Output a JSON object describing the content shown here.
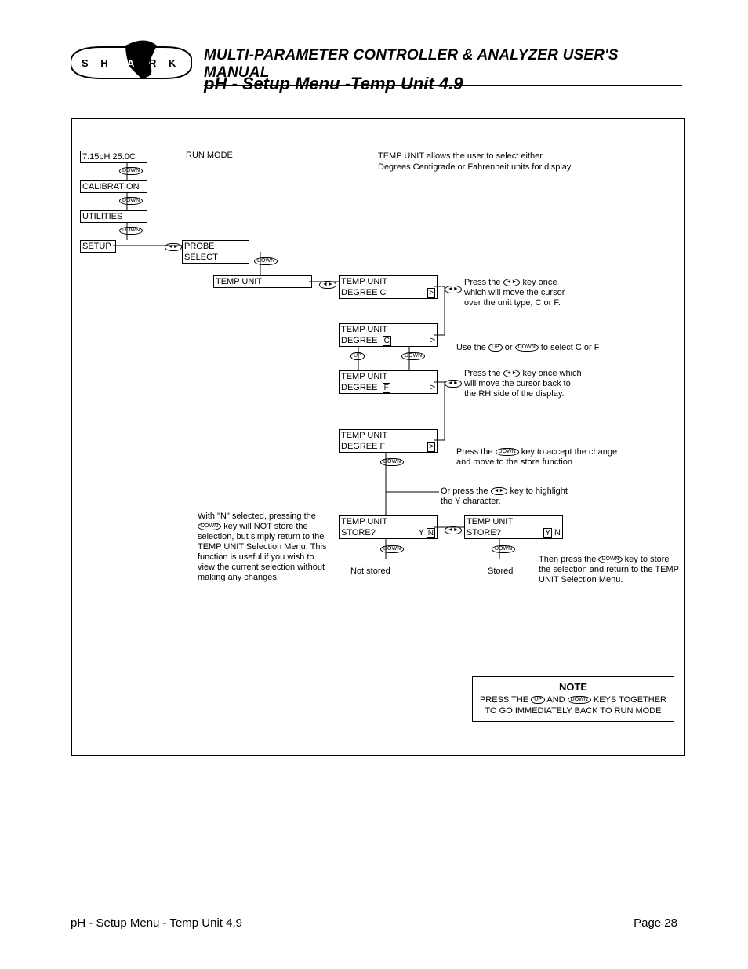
{
  "header": {
    "logo_text": "S H A R K",
    "title": "MULTI-PARAMETER CONTROLLER & ANALYZER USER'S MANUAL",
    "subtitle": "pH - Setup Menu -Temp Unit 4.9"
  },
  "nav": {
    "run_display": "7.15pH  25.0C",
    "run_mode_label": "RUN MODE",
    "calibration": "CALIBRATION",
    "utilities": "UTILITIES",
    "setup": "SETUP",
    "probe_select": "PROBE SELECT",
    "temp_unit": "TEMP UNIT"
  },
  "keys": {
    "down": "DOWN",
    "up": "UP",
    "left_right": "◄►"
  },
  "screens": {
    "tu1_line1": "TEMP UNIT",
    "tu1_line2a": "DEGREE   C",
    "tu2_line1": "TEMP UNIT",
    "tu2_degree": "DEGREE",
    "tu2_unit": "C",
    "tu3_line1": "TEMP UNIT",
    "tu3_degree": "DEGREE",
    "tu3_unit": "F",
    "tu4_line1": "TEMP UNIT",
    "tu4_line2": "DEGREE   F",
    "store_line1": "TEMP UNIT",
    "store_line2": "STORE?",
    "store_y": "Y",
    "store_n": "N"
  },
  "instructions": {
    "intro": "TEMP UNIT allows the user to select either Degrees Centigrade or Fahrenheit units for display",
    "step1_a": "Press the ",
    "step1_b": " key once which will move the cursor over the unit type, C or F.",
    "step2_a": "Use the ",
    "step2_or": " or ",
    "step2_b": " to select C or F",
    "step3_a": "Press the ",
    "step3_b": " key once which will move the cursor back to the RH side of the display.",
    "step4_a": "Press the ",
    "step4_b": " key to accept the change and move to the store function",
    "step5_a": "Or press the ",
    "step5_b": " key to highlight the Y character.",
    "left_note_a": "With \"N\" selected, pressing the ",
    "left_note_b": " key will NOT store the selection, but simply return to the TEMP UNIT Selection Menu. This function is useful if you wish to view the current selection without making any changes.",
    "right_note_a": "Then press the ",
    "right_note_b": " key to store the selection and return to the TEMP UNIT Selection Menu.",
    "not_stored": "Not stored",
    "stored": "Stored",
    "note_title": "NOTE",
    "note_body_a": "PRESS THE ",
    "note_body_and": " AND ",
    "note_body_b": " KEYS TOGETHER TO GO IMMEDIATELY BACK TO RUN MODE"
  },
  "footer": {
    "left": "pH - Setup Menu - Temp Unit 4.9",
    "right": "Page 28"
  }
}
